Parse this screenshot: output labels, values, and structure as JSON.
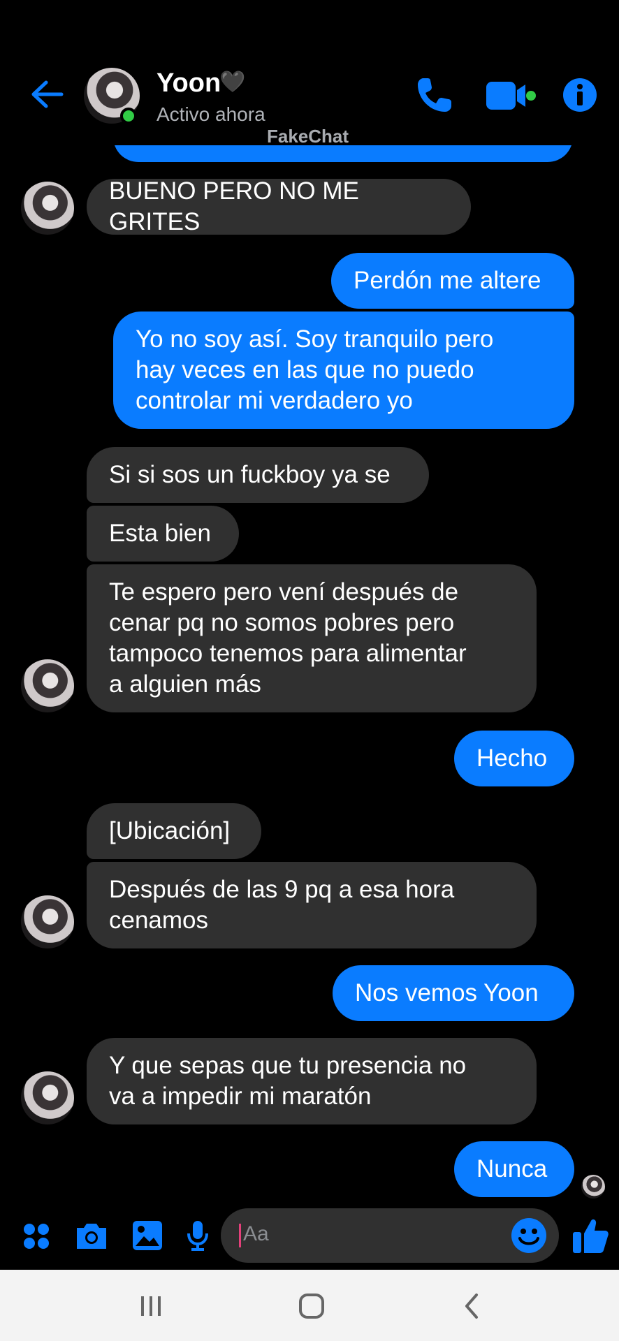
{
  "header": {
    "contact_name": "Yoon",
    "status": "Activo ahora",
    "watermark": "FakeChat"
  },
  "messages": [
    {
      "side": "in",
      "text": "BUENO PERO NO ME GRITES"
    },
    {
      "side": "out",
      "text": "Perdón me altere"
    },
    {
      "side": "out",
      "text": "Yo no soy así. Soy tranquilo pero\nhay veces en las que no puedo\ncontrolar mi verdadero yo"
    },
    {
      "side": "in",
      "text": "Si si sos un fuckboy ya se"
    },
    {
      "side": "in",
      "text": "Esta bien"
    },
    {
      "side": "in",
      "text": "Te espero pero vení después de\ncenar pq no somos pobres pero\ntampoco tenemos para alimentar\na alguien más"
    },
    {
      "side": "out",
      "text": "Hecho"
    },
    {
      "side": "in",
      "text": "[Ubicación]"
    },
    {
      "side": "in",
      "text": "Después de las 9 pq a esa hora\ncenamos"
    },
    {
      "side": "out",
      "text": "Nos vemos Yoon"
    },
    {
      "side": "in",
      "text": "Y que sepas que tu presencia no\nva a impedir mi maratón"
    },
    {
      "side": "out",
      "text": "Nunca"
    }
  ],
  "composer": {
    "placeholder": "Aa",
    "icons": [
      "apps-icon",
      "camera-icon",
      "gallery-icon",
      "mic-icon",
      "emoji-icon",
      "like-icon"
    ]
  },
  "navbar": {
    "icons": [
      "recents-icon",
      "home-icon",
      "back-icon"
    ]
  },
  "colors": {
    "accent": "#0a7cff",
    "incoming_bubble": "#303030",
    "online": "#31cc46"
  }
}
